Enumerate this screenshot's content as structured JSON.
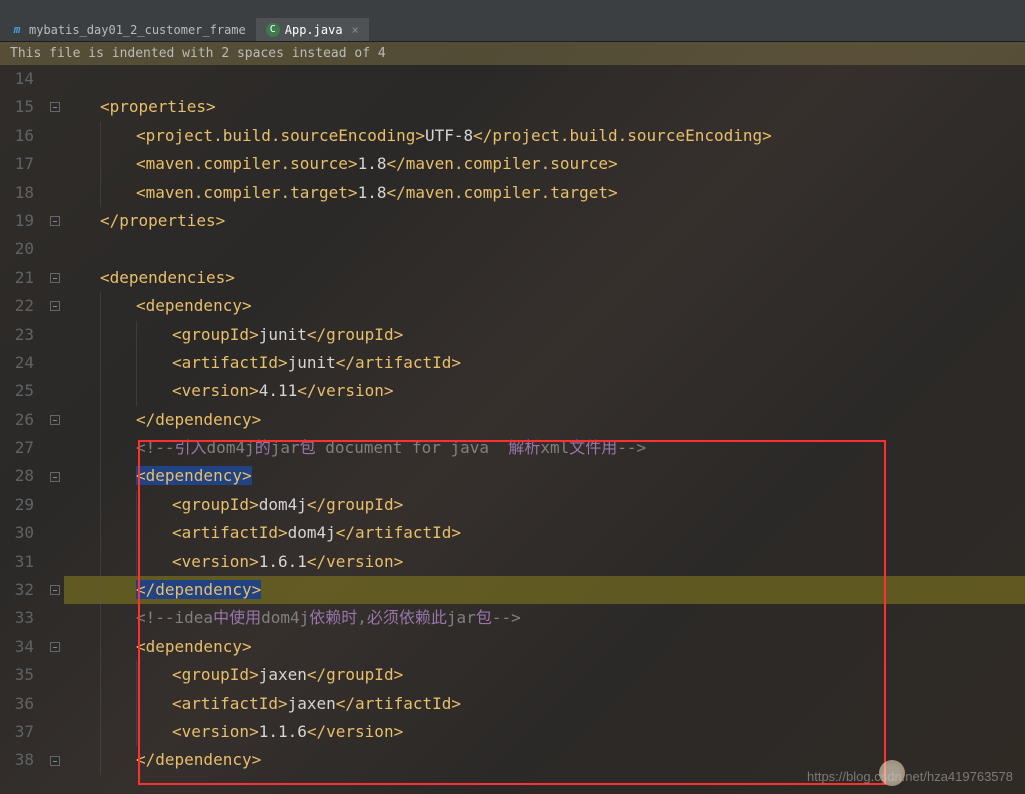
{
  "tabs": [
    {
      "icon": "m",
      "iconColor": "#4a9fd8",
      "label": "mybatis_day01_2_customer_frame",
      "active": false
    },
    {
      "icon": "C",
      "iconColor": "#6fb0e0",
      "label": "App.java",
      "active": true
    }
  ],
  "noticeBar": "This file is indented with 2 spaces instead of 4",
  "watermark": "https://blog.csdn.net/hza419763578",
  "lineNumbers": [
    "14",
    "15",
    "16",
    "17",
    "18",
    "19",
    "20",
    "21",
    "22",
    "23",
    "24",
    "25",
    "26",
    "27",
    "28",
    "29",
    "30",
    "31",
    "32",
    "33",
    "34",
    "35",
    "36",
    "37",
    "38"
  ],
  "foldRows": [
    1,
    5,
    7,
    8,
    12,
    14,
    18,
    20,
    24
  ],
  "code": {
    "l14": {
      "ind": 1,
      "segs": []
    },
    "l15": {
      "ind": 1,
      "segs": [
        {
          "c": "tag",
          "t": "<properties>"
        }
      ]
    },
    "l16": {
      "ind": 2,
      "segs": [
        {
          "c": "tag",
          "t": "<project.build.sourceEncoding>"
        },
        {
          "c": "txt",
          "t": "UTF-8"
        },
        {
          "c": "tag",
          "t": "</project.build.sourceEncoding>"
        }
      ]
    },
    "l17": {
      "ind": 2,
      "segs": [
        {
          "c": "tag",
          "t": "<maven.compiler.source>"
        },
        {
          "c": "txt",
          "t": "1.8"
        },
        {
          "c": "tag",
          "t": "</maven.compiler.source>"
        }
      ]
    },
    "l18": {
      "ind": 2,
      "segs": [
        {
          "c": "tag",
          "t": "<maven.compiler.target>"
        },
        {
          "c": "txt",
          "t": "1.8"
        },
        {
          "c": "tag",
          "t": "</maven.compiler.target>"
        }
      ]
    },
    "l19": {
      "ind": 1,
      "segs": [
        {
          "c": "tag",
          "t": "</properties>"
        }
      ]
    },
    "l20": {
      "ind": 1,
      "segs": []
    },
    "l21": {
      "ind": 1,
      "segs": [
        {
          "c": "tag",
          "t": "<dependencies>"
        }
      ]
    },
    "l22": {
      "ind": 2,
      "segs": [
        {
          "c": "tag",
          "t": "<dependency>"
        }
      ]
    },
    "l23": {
      "ind": 3,
      "segs": [
        {
          "c": "tag",
          "t": "<groupId>"
        },
        {
          "c": "txt",
          "t": "junit"
        },
        {
          "c": "tag",
          "t": "</groupId>"
        }
      ]
    },
    "l24": {
      "ind": 3,
      "segs": [
        {
          "c": "tag",
          "t": "<artifactId>"
        },
        {
          "c": "txt",
          "t": "junit"
        },
        {
          "c": "tag",
          "t": "</artifactId>"
        }
      ]
    },
    "l25": {
      "ind": 3,
      "segs": [
        {
          "c": "tag",
          "t": "<version>"
        },
        {
          "c": "txt",
          "t": "4.11"
        },
        {
          "c": "tag",
          "t": "</version>"
        }
      ]
    },
    "l26": {
      "ind": 2,
      "segs": [
        {
          "c": "tag",
          "t": "</dependency>"
        }
      ]
    },
    "l27": {
      "ind": 2,
      "segs": [
        {
          "c": "cmt",
          "t": "<!--"
        },
        {
          "c": "cmt-cn",
          "t": "引入"
        },
        {
          "c": "cmt",
          "t": "dom4j"
        },
        {
          "c": "cmt-cn",
          "t": "的"
        },
        {
          "c": "cmt",
          "t": "jar"
        },
        {
          "c": "cmt-cn",
          "t": "包"
        },
        {
          "c": "cmt",
          "t": " document for java  "
        },
        {
          "c": "cmt-cn",
          "t": "解析"
        },
        {
          "c": "cmt",
          "t": "xml"
        },
        {
          "c": "cmt-cn",
          "t": "文件用"
        },
        {
          "c": "cmt",
          "t": "-->"
        }
      ]
    },
    "l28": {
      "ind": 2,
      "segs": [
        {
          "c": "tag sel",
          "t": "<dependency>"
        }
      ]
    },
    "l29": {
      "ind": 3,
      "segs": [
        {
          "c": "tag",
          "t": "<groupId>"
        },
        {
          "c": "txt",
          "t": "dom4j"
        },
        {
          "c": "tag",
          "t": "</groupId>"
        }
      ]
    },
    "l30": {
      "ind": 3,
      "segs": [
        {
          "c": "tag",
          "t": "<artifactId>"
        },
        {
          "c": "txt",
          "t": "dom4j"
        },
        {
          "c": "tag",
          "t": "</artifactId>"
        }
      ]
    },
    "l31": {
      "ind": 3,
      "segs": [
        {
          "c": "tag",
          "t": "<version>"
        },
        {
          "c": "txt",
          "t": "1.6.1"
        },
        {
          "c": "tag",
          "t": "</version>"
        }
      ]
    },
    "l32": {
      "ind": 2,
      "hl": true,
      "segs": [
        {
          "c": "tag sel",
          "t": "</dependency>"
        }
      ]
    },
    "l33": {
      "ind": 2,
      "segs": [
        {
          "c": "cmt",
          "t": "<!--idea"
        },
        {
          "c": "cmt-cn",
          "t": "中使用"
        },
        {
          "c": "cmt",
          "t": "dom4j"
        },
        {
          "c": "cmt-cn",
          "t": "依赖时"
        },
        {
          "c": "cmt",
          "t": ","
        },
        {
          "c": "cmt-cn",
          "t": "必须依赖此"
        },
        {
          "c": "cmt",
          "t": "jar"
        },
        {
          "c": "cmt-cn",
          "t": "包"
        },
        {
          "c": "cmt",
          "t": "-->"
        }
      ]
    },
    "l34": {
      "ind": 2,
      "segs": [
        {
          "c": "tag",
          "t": "<dependency>"
        }
      ]
    },
    "l35": {
      "ind": 3,
      "segs": [
        {
          "c": "tag",
          "t": "<groupId>"
        },
        {
          "c": "txt",
          "t": "jaxen"
        },
        {
          "c": "tag",
          "t": "</groupId>"
        }
      ]
    },
    "l36": {
      "ind": 3,
      "segs": [
        {
          "c": "tag",
          "t": "<artifactId>"
        },
        {
          "c": "txt",
          "t": "jaxen"
        },
        {
          "c": "tag",
          "t": "</artifactId>"
        }
      ]
    },
    "l37": {
      "ind": 3,
      "segs": [
        {
          "c": "tag",
          "t": "<version>"
        },
        {
          "c": "txt",
          "t": "1.1.6"
        },
        {
          "c": "tag",
          "t": "</version>"
        }
      ]
    },
    "l38": {
      "ind": 2,
      "segs": [
        {
          "c": "tag",
          "t": "</dependency>"
        }
      ]
    }
  }
}
